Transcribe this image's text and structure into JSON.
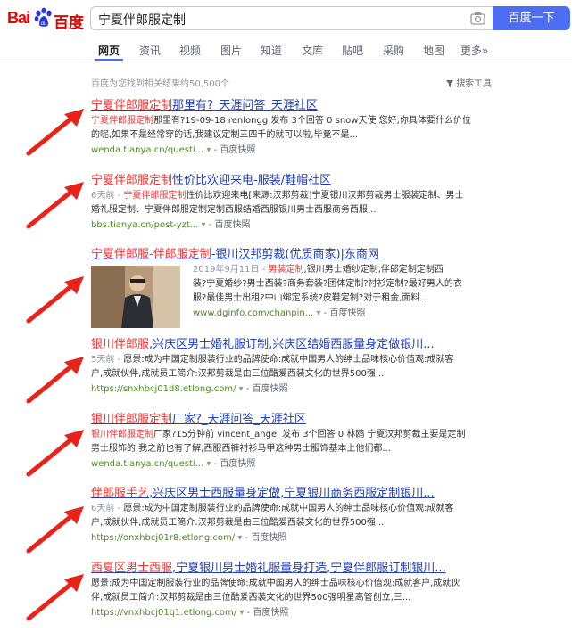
{
  "logo": {
    "bai": "Bai",
    "baidu": "百度"
  },
  "search": {
    "query": "宁夏伴郎服定制",
    "button": "百度一下"
  },
  "tabs": [
    "网页",
    "资讯",
    "视频",
    "图片",
    "知道",
    "文库",
    "贴吧",
    "采购",
    "地图",
    "更多»"
  ],
  "stats": "百度为您找到相关结果约50,500个",
  "tools": "搜索工具",
  "snapshot_label": "百度快照",
  "results": [
    {
      "title_a": "宁夏伴郎服定制",
      "title_b": "那里有?_天涯问答_天涯社区",
      "date": "",
      "abs_a": "宁夏伴郎服定制",
      "abs_b": "那里有?19-09-18 renlongg 发布 3个回答 0 snow天使 您好,你具体要什么价位",
      "abs_line2": "的呢,如果不是经常穿的话,我建议定制三四千的就可以啦,毕竟不是...",
      "url": "wenda.tianya.cn/questi..."
    },
    {
      "title_a": "宁夏伴郎服定制",
      "title_b": "性价比欢迎来电-服装/鞋帽社区",
      "date": "6天前 - ",
      "abs_a": "宁夏伴郎服定制",
      "abs_b": "性价比欢迎来电[来源:汉邦剪裁]宁夏银川汉邦剪裁男士服装定制、男士",
      "abs_line2": "婚礼服定制、宁夏伴郎服定制定制西服结婚西服银川男士西服商务西服...",
      "url": "bbs.tianya.cn/post-yzt..."
    },
    {
      "title_a": "宁夏伴郎服-伴郎服定制",
      "title_b": "-银川汉邦剪裁(优质商家)|东商网",
      "date": "2019年9月11日 - ",
      "abs_a": "男装定制",
      "abs_b": ",银川男士婚纱定制,伴郎定制定制西",
      "abs_line2": "装?宁夏婚纱?男士西装?商务套装?团体定制?衬衫定制?最好男人的衣",
      "abs_line3": "服?最佳男士出租?中山绑定系统?皮鞋定制?对于租金,面料...",
      "url": "www.dginfo.com/chanpin..."
    },
    {
      "title_a": "银川伴郎服",
      "title_b": ",兴庆区男士婚礼服订制,兴庆区结婚西服量身定做银川...",
      "date": "5天前 - ",
      "abs_a": "",
      "abs_b": "愿景:成为中国定制服装行业的品牌使命:成就中国男人的绅士品味核心价值观:成就客",
      "abs_line2": "户,成就伙伴,成就员工简介:汉邦剪裁是由三位酷爱西装文化的世界500强...",
      "url": "https://snxhbcj01d8.etlong.com/"
    },
    {
      "title_a": "银川伴郎服定制",
      "title_b": "厂家?_天涯问答_天涯社区",
      "date": "",
      "abs_a": "银川伴郎服定制",
      "abs_b": "厂家?15分钟前 vincent_angel 发布 3个回答 0 林鸥 宁夏汉邦剪裁主要是定制",
      "abs_line2": "男士服饰的,我之前也有了解,西服西裤衬衫马甲这种男士服饰基本上他们都...",
      "url": "wenda.tianya.cn/questi..."
    },
    {
      "title_a": "伴郎服手艺",
      "title_b": ",兴庆区男士西服量身定做,宁夏银川商务西服定制银川...",
      "date": "6天前 - ",
      "abs_a": "",
      "abs_b": "愿景:成为中国定制服装行业的品牌使命:成就中国男人的绅士品味核心价值观:成就客",
      "abs_line2": "户,成就伙伴,成就员工简介:汉邦剪裁是由三位酷爱西装文化的世界500强...",
      "url": "https://onxhbcj01r8.etlong.com/"
    },
    {
      "title_a": "西夏区男士西服",
      "title_b": ",宁夏银川男士婚礼服量身打造,宁夏伴郎服订制银川...",
      "date": "",
      "abs_a": "",
      "abs_b": "愿景:成为中国定制服装行业的品牌使命:成就中国男人的绅士品味核心价值观:成就客户,成就伙",
      "abs_line2": "伴,成就员工简介:汉邦剪裁是由三位酷爱西装文化的世界500强明星高管创立,三...",
      "url": "https://vnxhbcj01q1.etlong.com/"
    }
  ]
}
